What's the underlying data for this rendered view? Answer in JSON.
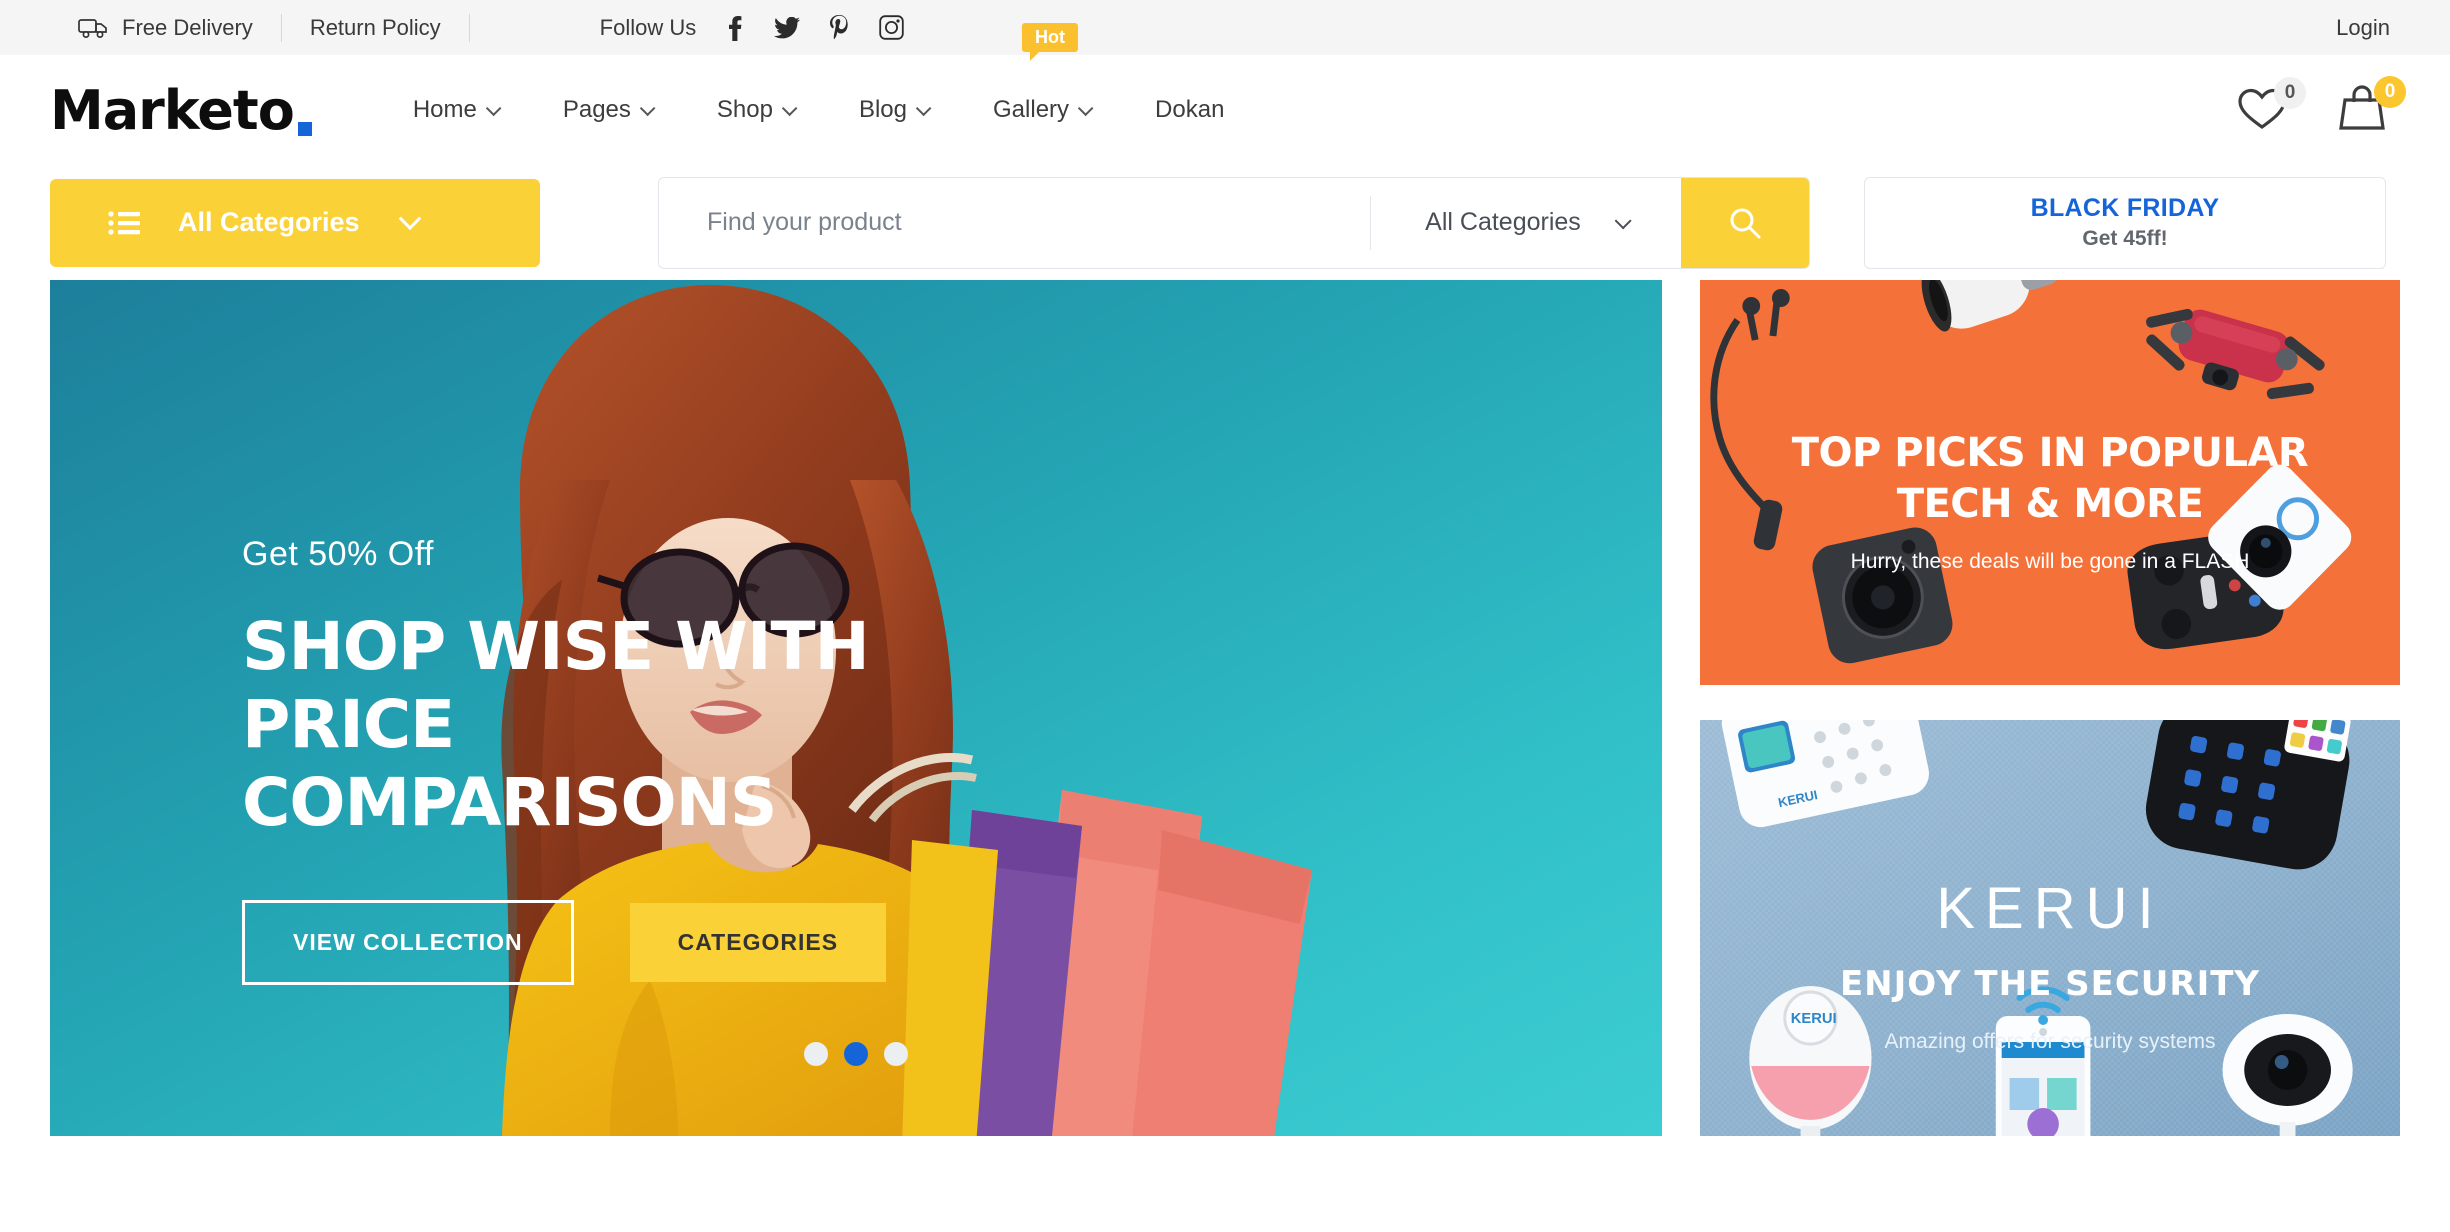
{
  "topbar": {
    "free_delivery": "Free Delivery",
    "return_policy": "Return Policy",
    "follow_us": "Follow Us",
    "socials": [
      "facebook-icon",
      "twitter-icon",
      "pinterest-icon",
      "instagram-icon"
    ],
    "login": "Login"
  },
  "header": {
    "logo_text": "Marketo",
    "logo_accent_color": "#1565d8",
    "nav": [
      {
        "label": "Home",
        "has_dropdown": true,
        "badge": null
      },
      {
        "label": "Pages",
        "has_dropdown": true,
        "badge": null
      },
      {
        "label": "Shop",
        "has_dropdown": true,
        "badge": null
      },
      {
        "label": "Blog",
        "has_dropdown": true,
        "badge": null
      },
      {
        "label": "Gallery",
        "has_dropdown": true,
        "badge": "Hot"
      },
      {
        "label": "Dokan",
        "has_dropdown": false,
        "badge": null
      }
    ],
    "wishlist_count": "0",
    "cart_count": "0"
  },
  "search": {
    "categories_button": "All Categories",
    "placeholder": "Find your product",
    "value": "",
    "select_value": "All Categories",
    "search_icon": "search-icon"
  },
  "promo_box": {
    "title": "BLACK FRIDAY",
    "subtitle": "Get 45ff!",
    "title_color": "#1565d8"
  },
  "hero": {
    "kicker": "Get 50% Off",
    "title": "SHOP WISE WITH PRICE COMPARISONS",
    "btn_primary": "VIEW COLLECTION",
    "btn_secondary": "CATEGORIES",
    "slides": 3,
    "active_slide": 2,
    "bg_color": "#21a3b4"
  },
  "promo_tech": {
    "line1": "TOP PICKS IN POPULAR",
    "line2": "TECH & MORE",
    "subtitle": "Hurry, these deals will be gone in a FLASH",
    "bg_color": "#f4713a"
  },
  "promo_security": {
    "brand": "KERUI",
    "headline": "ENJOY THE SECURITY",
    "subtitle": "Amazing offers for security systems",
    "bg_color": "#8fb2cf"
  }
}
